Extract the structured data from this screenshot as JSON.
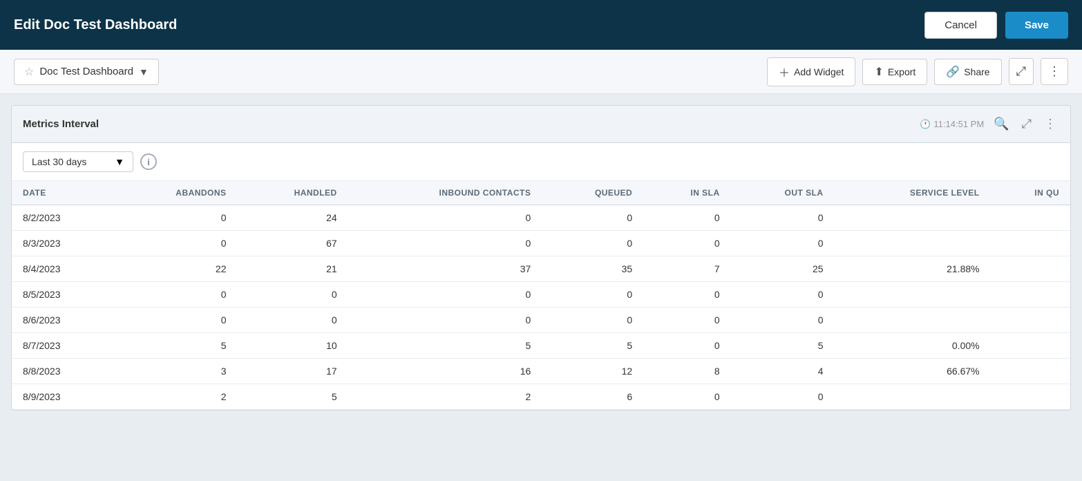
{
  "header": {
    "title": "Edit Doc Test Dashboard",
    "cancel_label": "Cancel",
    "save_label": "Save"
  },
  "toolbar": {
    "dashboard_name": "Doc Test Dashboard",
    "star_icon": "☆",
    "chevron_icon": "▼",
    "add_widget_label": "Add Widget",
    "export_label": "Export",
    "share_label": "Share",
    "fullscreen_icon": "⤢",
    "more_icon": "⋮"
  },
  "widget": {
    "title": "Metrics Interval",
    "timestamp": "11:14:51 PM",
    "interval_label": "Last 30 days",
    "columns": [
      "DATE",
      "ABANDONS",
      "HANDLED",
      "INBOUND CONTACTS",
      "QUEUED",
      "IN SLA",
      "OUT SLA",
      "SERVICE LEVEL",
      "IN QU"
    ],
    "rows": [
      {
        "date": "8/2/2023",
        "abandons": 0,
        "handled": 24,
        "inbound_contacts": 0,
        "queued": 0,
        "in_sla": 0,
        "out_sla": 0,
        "service_level": "",
        "in_qu": ""
      },
      {
        "date": "8/3/2023",
        "abandons": 0,
        "handled": 67,
        "inbound_contacts": 0,
        "queued": 0,
        "in_sla": 0,
        "out_sla": 0,
        "service_level": "",
        "in_qu": ""
      },
      {
        "date": "8/4/2023",
        "abandons": 22,
        "handled": 21,
        "inbound_contacts": 37,
        "queued": 35,
        "in_sla": 7,
        "out_sla": 25,
        "service_level": "21.88%",
        "in_qu": ""
      },
      {
        "date": "8/5/2023",
        "abandons": 0,
        "handled": 0,
        "inbound_contacts": 0,
        "queued": 0,
        "in_sla": 0,
        "out_sla": 0,
        "service_level": "",
        "in_qu": ""
      },
      {
        "date": "8/6/2023",
        "abandons": 0,
        "handled": 0,
        "inbound_contacts": 0,
        "queued": 0,
        "in_sla": 0,
        "out_sla": 0,
        "service_level": "",
        "in_qu": ""
      },
      {
        "date": "8/7/2023",
        "abandons": 5,
        "handled": 10,
        "inbound_contacts": 5,
        "queued": 5,
        "in_sla": 0,
        "out_sla": 5,
        "service_level": "0.00%",
        "in_qu": ""
      },
      {
        "date": "8/8/2023",
        "abandons": 3,
        "handled": 17,
        "inbound_contacts": 16,
        "queued": 12,
        "in_sla": 8,
        "out_sla": 4,
        "service_level": "66.67%",
        "in_qu": ""
      },
      {
        "date": "8/9/2023",
        "abandons": 2,
        "handled": 5,
        "inbound_contacts": 2,
        "queued": 6,
        "in_sla": 0,
        "out_sla": 0,
        "service_level": "",
        "in_qu": ""
      }
    ]
  }
}
